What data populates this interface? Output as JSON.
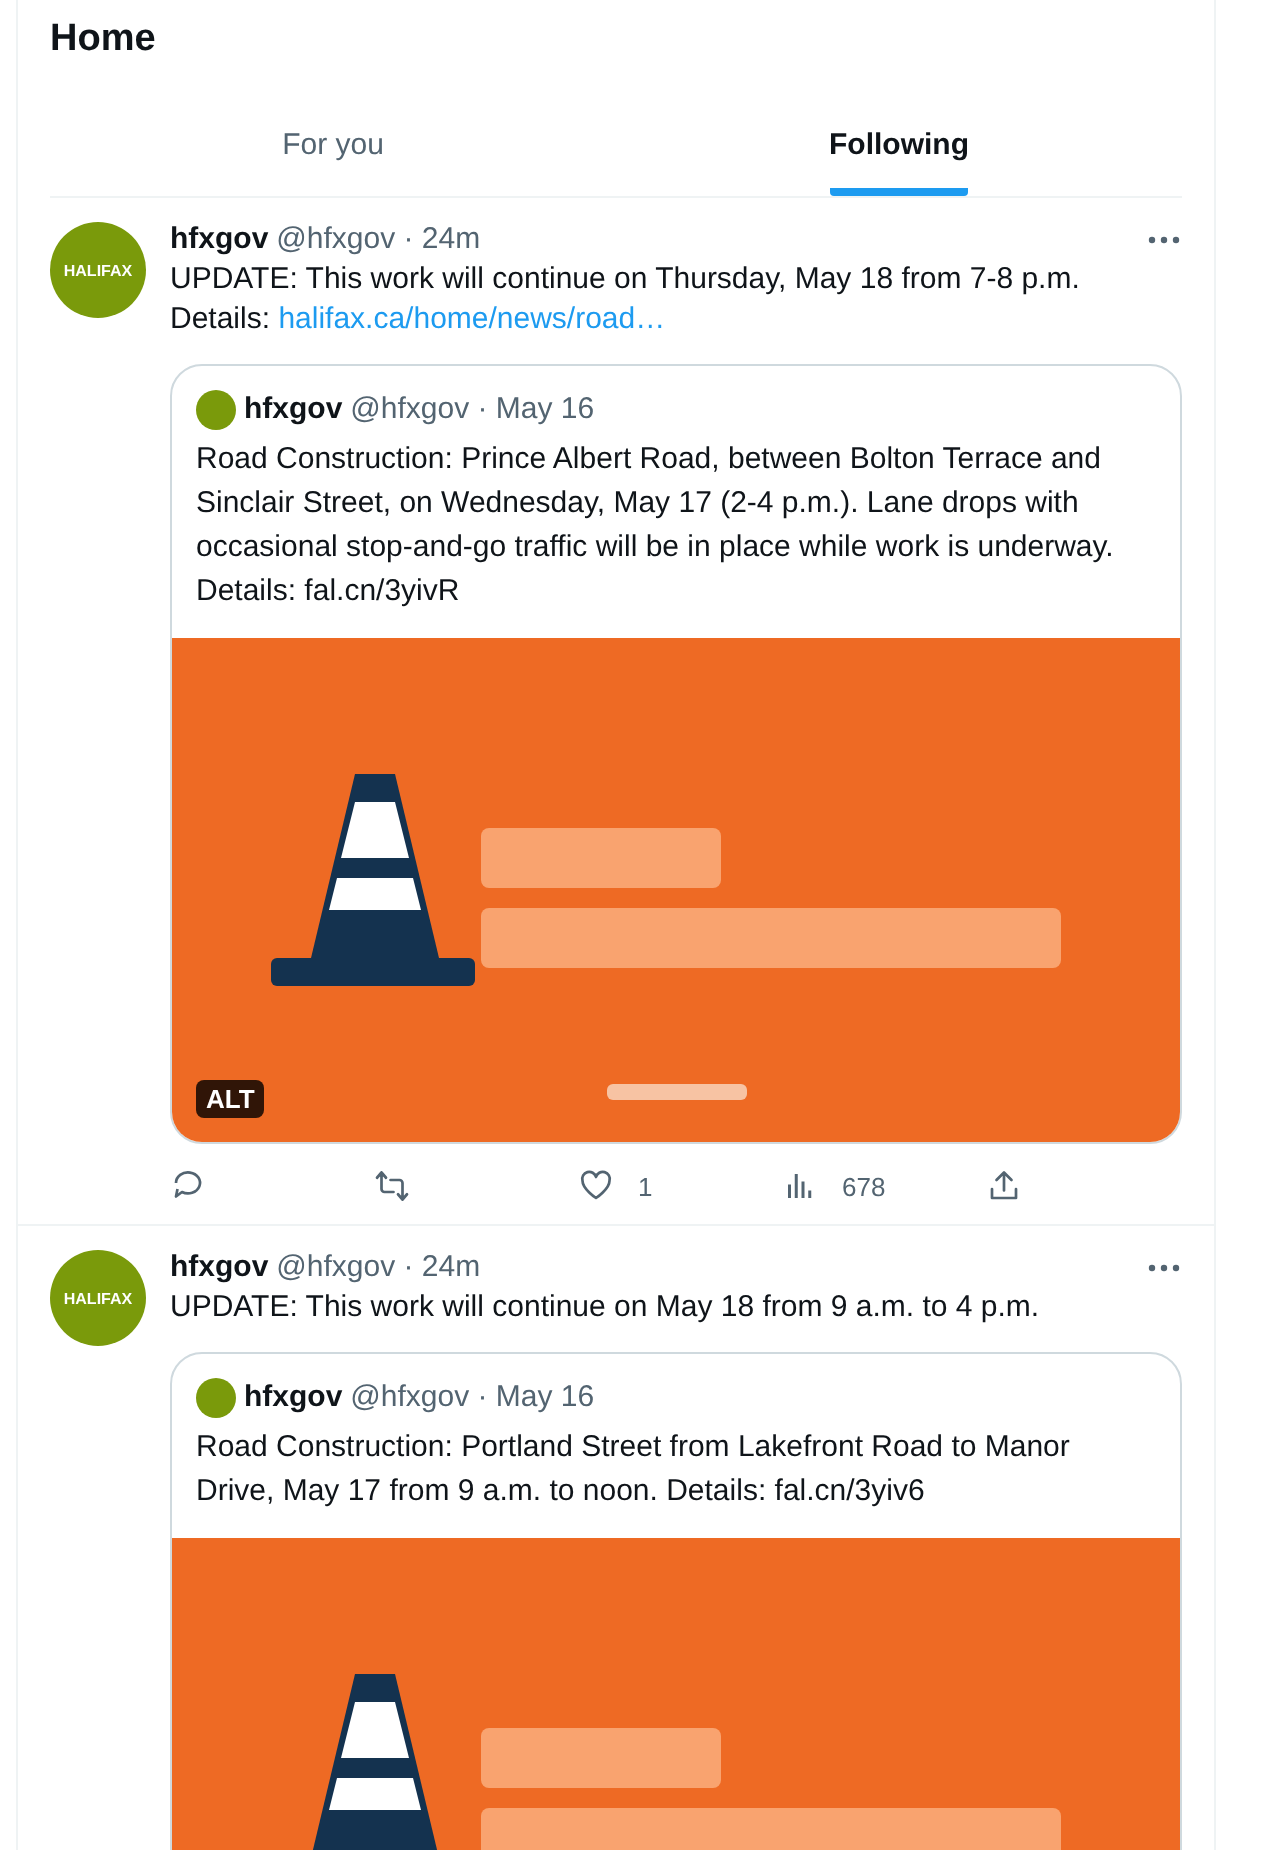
{
  "header": {
    "title": "Home"
  },
  "tabs": [
    {
      "label": "For you",
      "selected": false
    },
    {
      "label": "Following",
      "selected": true
    }
  ],
  "tweets": [
    {
      "avatar_text": "HALIFAX",
      "name": "hfxgov",
      "meta": "@hfxgov · 24m",
      "text": "UPDATE: This work will continue on Thursday, May 18 from 7-8 p.m.\nDetails: ",
      "link": "halifax.ca/home/news/road…",
      "quote": {
        "name": "hfxgov",
        "meta": "@hfxgov · May 16",
        "text": "Road Construction: Prince Albert Road, between Bolton Terrace and Sinclair Street, on Wednesday, May 17 (2-4 p.m.). Lane drops with occasional stop-and-go traffic will be in place while work is underway. Details: fal.cn/3yivR",
        "media": {
          "kind": "picture",
          "badge": "ALT"
        }
      },
      "actions": [
        {
          "kind": "reply"
        },
        {
          "kind": "repost"
        },
        {
          "kind": "like",
          "count": "1"
        },
        {
          "kind": "views",
          "count": "678"
        },
        {
          "kind": "share"
        }
      ]
    },
    {
      "avatar_text": "HALIFAX",
      "name": "hfxgov",
      "meta": "@hfxgov · 24m",
      "text": "UPDATE: This work will continue on May 18 from 9 a.m. to 4 p.m.",
      "quote": {
        "name": "hfxgov",
        "meta": "@hfxgov · May 16",
        "text": "Road Construction: Portland Street from Lakefront Road to Manor Drive, May 17 from 9 a.m. to noon. Details: fal.cn/3yiv6"
      }
    }
  ]
}
